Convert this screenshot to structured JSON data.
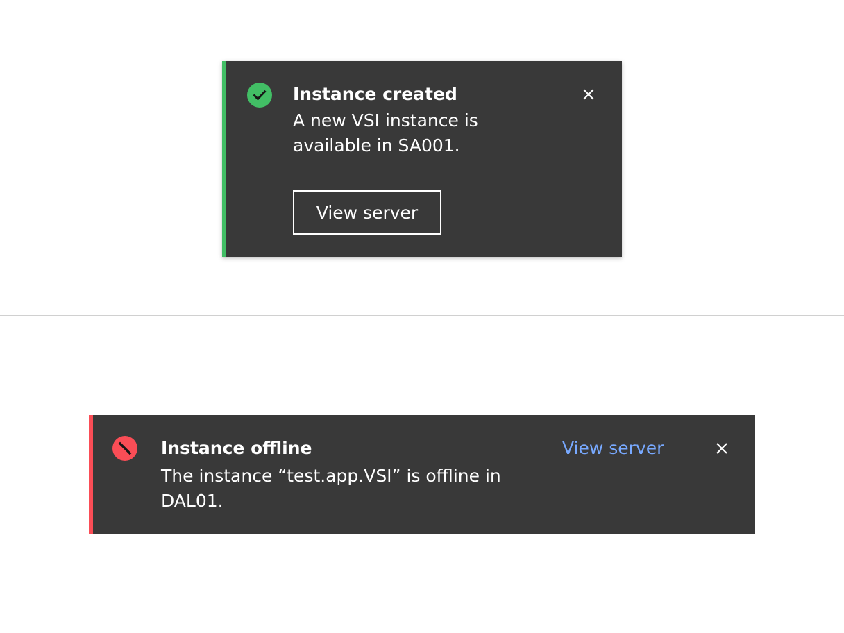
{
  "toast": {
    "status": "success",
    "status_icon": "checkmark-filled-icon",
    "accent_color": "#42be65",
    "title": "Instance created",
    "subtitle": "A new VSI instance is available in SA001.",
    "action_label": "View server",
    "close_icon": "close-icon"
  },
  "inline_notification": {
    "status": "error",
    "status_icon": "error-filled-icon",
    "accent_color": "#fa4d56",
    "title": "Instance offline",
    "subtitle": "The instance “test.app.VSI” is offline in DAL01.",
    "action_label": "View server",
    "action_color": "#78a9ff",
    "close_icon": "close-icon"
  }
}
